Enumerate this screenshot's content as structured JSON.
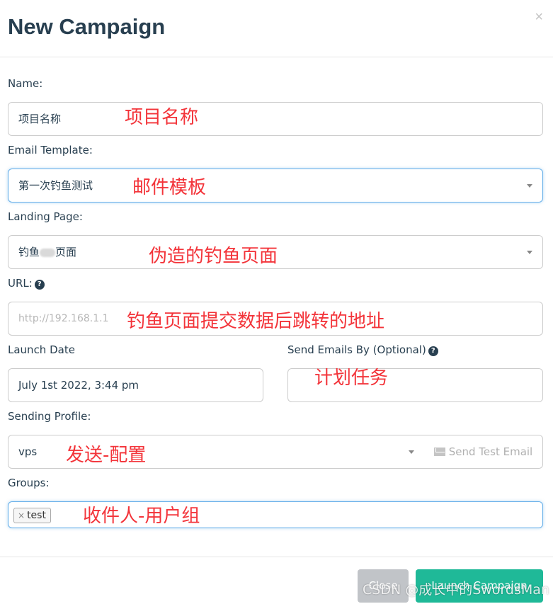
{
  "modal": {
    "title": "New Campaign",
    "close_symbol": "×"
  },
  "name": {
    "label": "Name:",
    "value": "项目名称",
    "annotation": "项目名称"
  },
  "email_template": {
    "label": "Email Template:",
    "value": "第一次钓鱼测试",
    "annotation": "邮件模板"
  },
  "landing_page": {
    "label": "Landing Page:",
    "value_start": "钓鱼",
    "value_end": "页面",
    "annotation": "伪造的钓鱼页面"
  },
  "url": {
    "label": "URL:",
    "help_symbol": "?",
    "placeholder": "http://192.168.1.1",
    "annotation": "钓鱼页面提交数据后跳转的地址"
  },
  "launch_date": {
    "label": "Launch Date",
    "value": "July 1st 2022, 3:44 pm"
  },
  "send_by": {
    "label": "Send Emails By (Optional)",
    "help_symbol": "?",
    "value": "",
    "annotation": "计划任务"
  },
  "sending_profile": {
    "label": "Sending Profile:",
    "value": "vps",
    "annotation": "发送-配置",
    "test_button": "Send Test Email"
  },
  "groups": {
    "label": "Groups:",
    "tags": [
      "test"
    ],
    "tag_remove": "×",
    "annotation": "收件人-用户组"
  },
  "footer": {
    "close_label": "Close",
    "launch_label": "Launch Campaign"
  },
  "watermark": "CSDN @成长中的SwordsMan",
  "colors": {
    "accent": "#1fb998",
    "annotation_red": "#f3343a",
    "focus_border": "#66afe9",
    "text": "#283f50"
  }
}
